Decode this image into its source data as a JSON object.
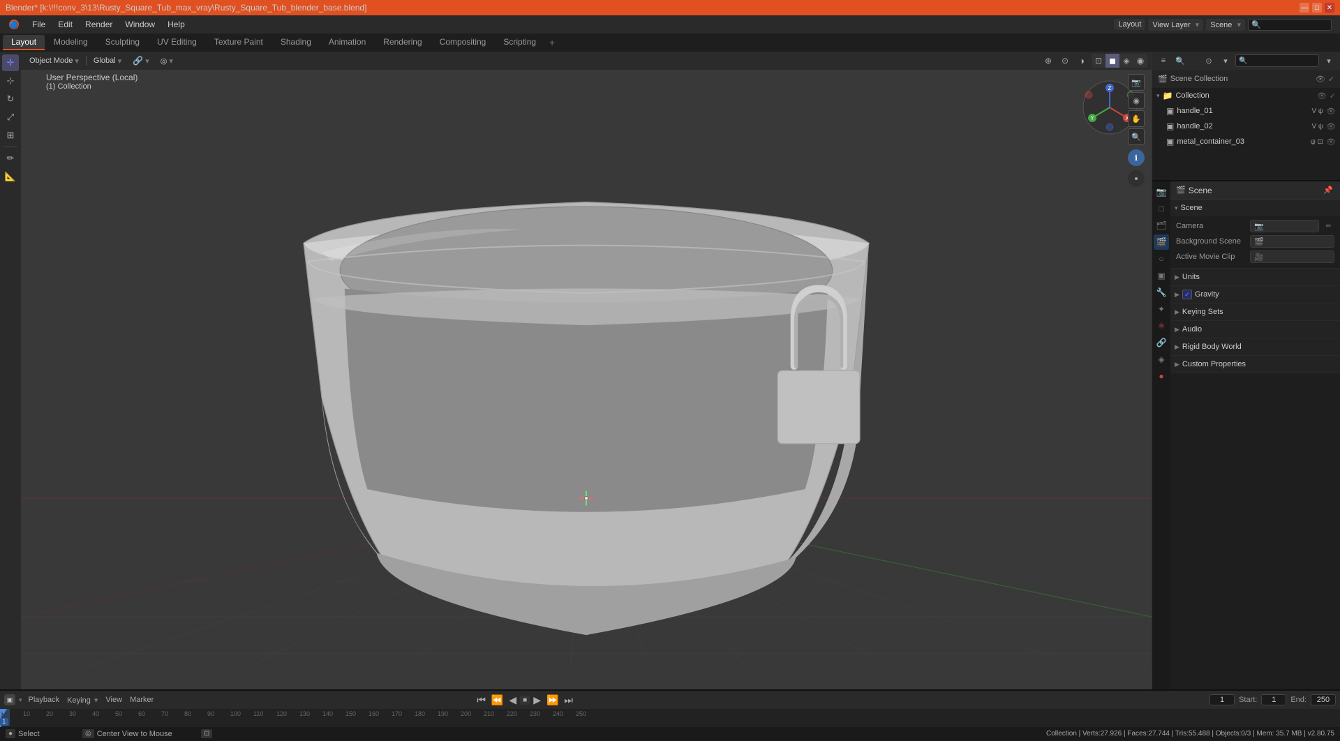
{
  "titlebar": {
    "title": "Blender* [k:\\!!!conv_3\\13\\Rusty_Square_Tub_max_vray\\Rusty_Square_Tub_blender_base.blend]",
    "controls": [
      "—",
      "□",
      "✕"
    ]
  },
  "menubar": {
    "items": [
      "Blender",
      "File",
      "Edit",
      "Render",
      "Window",
      "Help"
    ]
  },
  "workspaces": {
    "tabs": [
      "Layout",
      "Modeling",
      "Sculpting",
      "UV Editing",
      "Texture Paint",
      "Shading",
      "Animation",
      "Rendering",
      "Compositing",
      "Scripting",
      "+"
    ],
    "active": "Layout"
  },
  "toolbar_left": {
    "tools": [
      {
        "name": "cursor",
        "icon": "✛",
        "active": false
      },
      {
        "name": "move",
        "icon": "⊹",
        "active": false
      },
      {
        "name": "rotate",
        "icon": "↻",
        "active": false
      },
      {
        "name": "scale",
        "icon": "⤢",
        "active": false
      },
      {
        "name": "transform",
        "icon": "⊞",
        "active": false
      },
      {
        "name": "annotate",
        "icon": "✏",
        "active": false
      },
      {
        "name": "measure",
        "icon": "📏",
        "active": false
      }
    ]
  },
  "viewport": {
    "mode": "Object Mode",
    "view": "User Perspective (Local)",
    "collection": "(1) Collection",
    "global": "Global",
    "snap_icon": "🔗",
    "prop_editing_icon": "◎"
  },
  "viewport_header_right": {
    "icons": [
      "🔍",
      "⊕",
      "✋",
      "🔍",
      "ℹ"
    ],
    "display_modes": [
      "solid",
      "wireframe",
      "material",
      "render"
    ]
  },
  "nav_gizmo": {
    "x_label": "X",
    "y_label": "Y",
    "z_label": "Z"
  },
  "outliner": {
    "header": "Scene Collection",
    "items": [
      {
        "name": "Collection",
        "type": "collection",
        "indent": 0,
        "expanded": true,
        "visible": true
      },
      {
        "name": "handle_01",
        "type": "mesh",
        "indent": 1,
        "visible": true
      },
      {
        "name": "handle_02",
        "type": "mesh",
        "indent": 1,
        "visible": true
      },
      {
        "name": "metal_container_03",
        "type": "mesh",
        "indent": 1,
        "visible": true
      }
    ]
  },
  "properties": {
    "active_tab": "scene",
    "tabs": [
      {
        "name": "render",
        "icon": "📷"
      },
      {
        "name": "output",
        "icon": "🖨"
      },
      {
        "name": "view-layer",
        "icon": "🗂"
      },
      {
        "name": "scene",
        "icon": "🎬"
      },
      {
        "name": "world",
        "icon": "🌍"
      },
      {
        "name": "object",
        "icon": "▣"
      },
      {
        "name": "modifiers",
        "icon": "🔧"
      },
      {
        "name": "particles",
        "icon": "✦"
      },
      {
        "name": "physics",
        "icon": "⚛"
      },
      {
        "name": "constraints",
        "icon": "🔗"
      },
      {
        "name": "data",
        "icon": "◈"
      },
      {
        "name": "material",
        "icon": "●"
      }
    ],
    "scene_header": "Scene",
    "sections": [
      {
        "name": "scene",
        "label": "Scene",
        "expanded": true,
        "rows": [
          {
            "label": "Camera",
            "value": "",
            "has_icon": true
          },
          {
            "label": "Background Scene",
            "value": "",
            "has_icon": true
          },
          {
            "label": "Active Movie Clip",
            "value": "",
            "has_icon": true
          }
        ]
      },
      {
        "name": "units",
        "label": "Units",
        "expanded": false,
        "rows": []
      },
      {
        "name": "gravity",
        "label": "Gravity",
        "expanded": false,
        "has_checkbox": true,
        "rows": []
      },
      {
        "name": "keying-sets",
        "label": "Keying Sets",
        "expanded": false,
        "rows": []
      },
      {
        "name": "audio",
        "label": "Audio",
        "expanded": false,
        "rows": []
      },
      {
        "name": "rigid-body-world",
        "label": "Rigid Body World",
        "expanded": false,
        "rows": []
      },
      {
        "name": "custom-properties",
        "label": "Custom Properties",
        "expanded": false,
        "rows": []
      }
    ]
  },
  "timeline": {
    "playback_label": "Playback",
    "keying_label": "Keying",
    "view_label": "View",
    "marker_label": "Marker",
    "frame_current": "1",
    "frame_start_label": "Start:",
    "frame_start": "1",
    "frame_end_label": "End:",
    "frame_end": "250",
    "frame_markers": [
      1,
      10,
      20,
      30,
      40,
      50,
      60,
      70,
      80,
      90,
      100,
      110,
      120,
      130,
      140,
      150,
      160,
      170,
      180,
      190,
      200,
      210,
      220,
      230,
      240,
      250
    ]
  },
  "statusbar": {
    "left": "Select",
    "center": "Center View to Mouse",
    "right": "Collection | Verts:27.926 | Faces:27.744 | Tris:55.488 | Objects:0/3 | Mem: 35.7 MB | v2.80.75"
  },
  "right_panel_top_icons": [
    {
      "name": "scene-icon",
      "icon": "📷",
      "active": false
    },
    {
      "name": "output-icon",
      "icon": "□",
      "active": false
    },
    {
      "name": "viewlayer-icon",
      "icon": "🗂",
      "active": false
    },
    {
      "name": "scene-prop-icon",
      "icon": "🎬",
      "active": true
    },
    {
      "name": "world-icon",
      "icon": "○",
      "active": false
    },
    {
      "name": "object-icon",
      "icon": "▣",
      "active": false
    }
  ],
  "colors": {
    "accent": "#e05020",
    "active_tab_bg": "#3a3a3a",
    "sidebar_bg": "#2a2a2a",
    "viewport_bg": "#393939",
    "panel_bg": "#1e1e1e",
    "header_bg": "#2a2a2a"
  }
}
